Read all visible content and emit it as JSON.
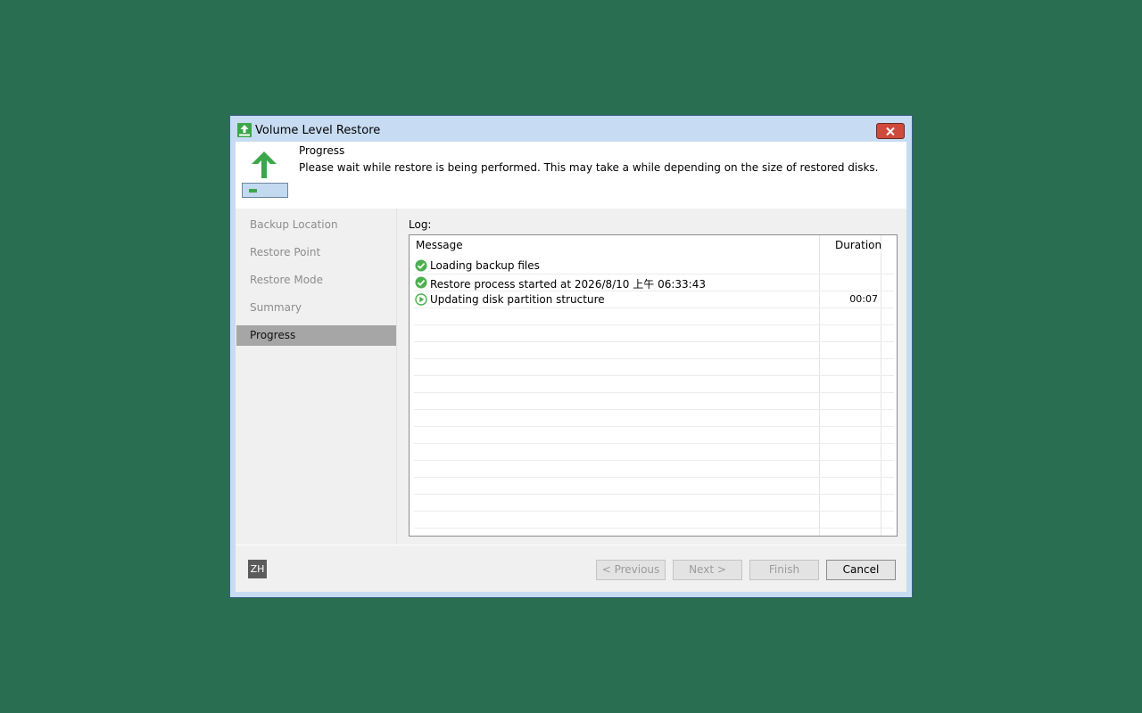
{
  "window": {
    "title": "Volume Level Restore"
  },
  "header": {
    "title": "Progress",
    "description": "Please wait while restore is being performed. This may take a while depending on the size of restored disks."
  },
  "sidebar": {
    "items": [
      {
        "label": "Backup Location"
      },
      {
        "label": "Restore Point"
      },
      {
        "label": "Restore Mode"
      },
      {
        "label": "Summary"
      },
      {
        "label": "Progress"
      }
    ],
    "active_index": 4
  },
  "log": {
    "label": "Log:",
    "columns": {
      "message": "Message",
      "duration": "Duration"
    },
    "rows": [
      {
        "status": "check-circle-icon",
        "message": "Loading backup files",
        "duration": ""
      },
      {
        "status": "check-circle-icon",
        "message": "Restore process started at 2026/8/10 上午 06:33:43",
        "duration": ""
      },
      {
        "status": "play-circle-icon",
        "message": "Updating disk partition structure",
        "duration": "00:07"
      }
    ]
  },
  "footer": {
    "lang_badge": "ZH",
    "buttons": {
      "previous": "< Previous",
      "next": "Next >",
      "finish": "Finish",
      "cancel": "Cancel"
    }
  },
  "colors": {
    "desktop": "#2a6e52",
    "titlebar": "#c7dcf2",
    "accent_green": "#3ca64a",
    "close_red": "#cf4a3c",
    "sidebar_active": "#a6a6a6"
  }
}
